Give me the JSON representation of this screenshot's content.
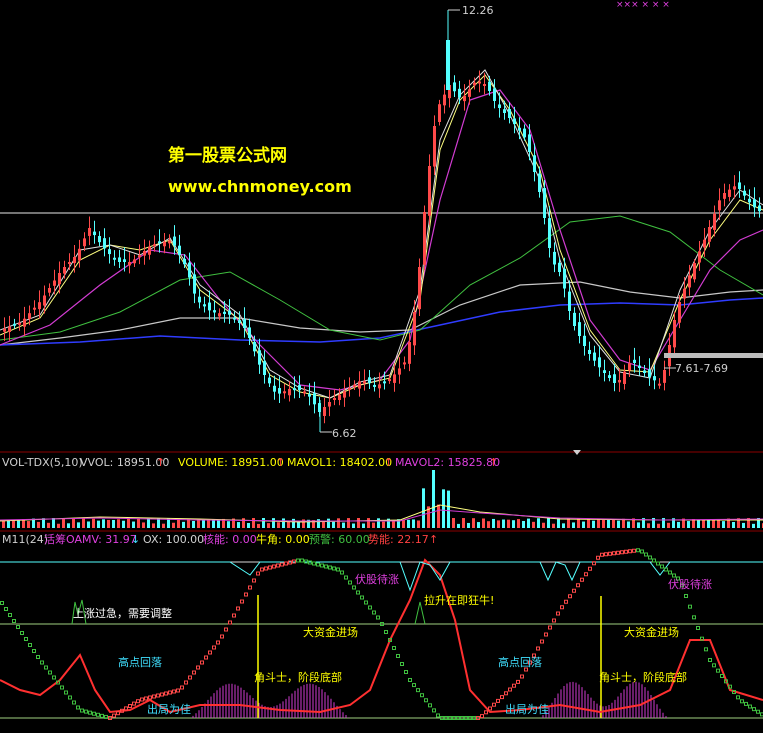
{
  "watermark": {
    "line1": "第一股票公式网",
    "line2": "www.chnmoney.com"
  },
  "price_panel": {
    "high_label": "12.26",
    "low_label": "6.62",
    "right_label": "7.61-7.69",
    "top_markers": "××× × × ×"
  },
  "vol_panel": {
    "name": "VOL-TDX(5,10)",
    "vvol": "VVOL: 18951.00",
    "volume": "VOLUME: 18951.00",
    "mavol1": "MAVOL1: 18402.00",
    "mavol2": "MAVOL2: 15825.80",
    "arrow": "↑"
  },
  "indicator_panel": {
    "name": "M11(24)",
    "oamv": "活筹OAMV: 31.97",
    "oamv_arrow": "↓",
    "ox": "OX: 100.00",
    "core": "核能: 0.00",
    "bull": "牛角: 0.00",
    "warn": "预警: 60.00",
    "momentum": "势能: 22.17",
    "momentum_arrow": "↑",
    "annotations": {
      "rise_fast": "上涨过急，需要调整",
      "high_drop_1": "高点回落",
      "exit_1": "出局为佳",
      "fighter_1": "角斗士，阶段底部",
      "wait_1": "伏股待涨",
      "bull_soon": "拉升在即狂牛!",
      "big_fund_1": "大资金进场",
      "high_drop_2": "高点回落",
      "exit_2": "出局为佳",
      "fighter_2": "角斗士，阶段底部",
      "big_fund_2": "大资金进场",
      "wait_2": "伏股待涨"
    }
  },
  "colors": {
    "background": "#000000",
    "up": "#ff4a4a",
    "down": "#54ffff",
    "ma_white": "#e0e0e0",
    "ma_yellow": "#ffff80",
    "ma_magenta": "#d23cd2",
    "ma_green": "#40c040",
    "ma_blue": "#2f3cff",
    "ma_gray": "#c8c8c8",
    "label_yellow": "#ffff00",
    "label_magenta": "#e040e0",
    "label_red": "#ff3030",
    "label_cyan": "#40e0ff"
  }
}
